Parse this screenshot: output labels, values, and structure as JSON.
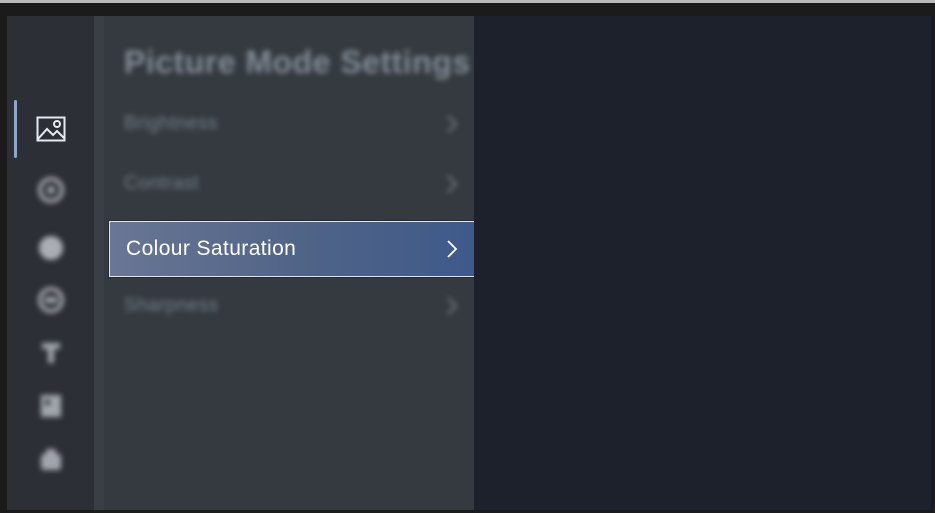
{
  "menu": {
    "title": "Picture Mode Settings",
    "items": [
      {
        "label": "Brightness",
        "state": "blurred"
      },
      {
        "label": "Contrast",
        "state": "blurred"
      },
      {
        "label": "Colour Saturation",
        "state": "focused"
      },
      {
        "label": "Sharpness",
        "state": "blurred"
      }
    ],
    "chevron": ">"
  },
  "sidebar": {
    "icons": [
      {
        "name": "picture-icon",
        "selected": true
      },
      {
        "name": "sound-icon",
        "selected": false
      },
      {
        "name": "network-icon",
        "selected": false
      },
      {
        "name": "channel-icon",
        "selected": false
      },
      {
        "name": "accessibility-icon",
        "selected": false
      },
      {
        "name": "system-icon",
        "selected": false
      },
      {
        "name": "support-icon",
        "selected": false
      }
    ]
  },
  "colors": {
    "accent": "#4f6387",
    "selection_border": "#dfe5ee",
    "rail_indicator": "#8ea7c8"
  }
}
